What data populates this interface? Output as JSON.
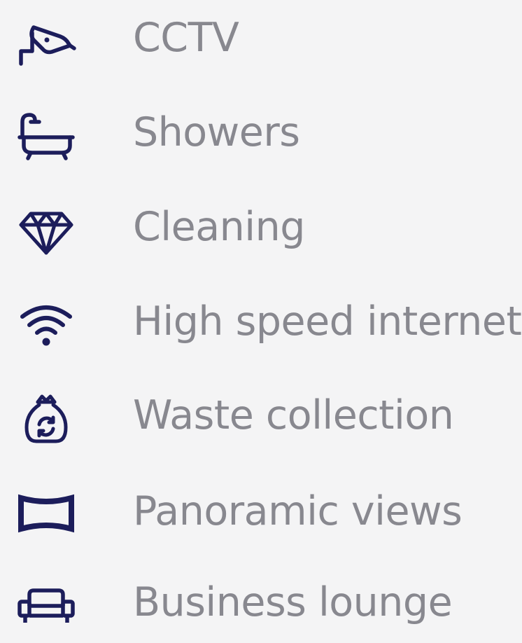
{
  "colors": {
    "background": "#f4f4f5",
    "icon": "#1c1d5b",
    "label": "#88888f"
  },
  "amenities": [
    {
      "label": "CCTV",
      "icon": "cctv-camera-icon"
    },
    {
      "label": "Showers",
      "icon": "bathtub-shower-icon"
    },
    {
      "label": "Cleaning",
      "icon": "diamond-icon"
    },
    {
      "label": "High speed internet",
      "icon": "wifi-icon"
    },
    {
      "label": "Waste collection",
      "icon": "recycling-bag-icon"
    },
    {
      "label": "Panoramic views",
      "icon": "panorama-icon"
    },
    {
      "label": "Business lounge",
      "icon": "sofa-icon"
    }
  ]
}
